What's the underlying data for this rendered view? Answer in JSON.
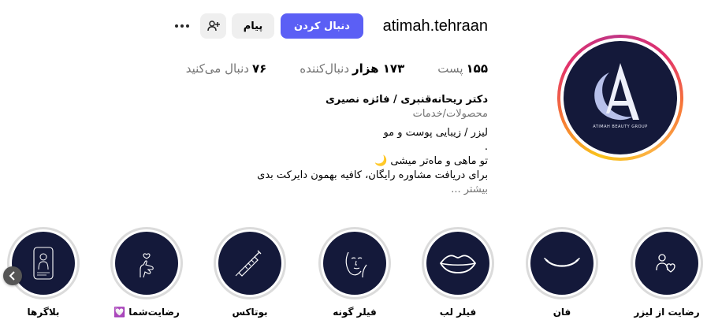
{
  "profile": {
    "username": "atimah.tehraan",
    "avatar_brand": "ATIMAH BEAUTY GROUP"
  },
  "actions": {
    "follow_label": "دنبال کردن",
    "message_label": "پیام",
    "add_user_icon": "person-add-icon",
    "more_icon": "more-horizontal-icon"
  },
  "stats": {
    "posts_count": "۱۵۵",
    "posts_label": "پست",
    "followers_count": "۱۷۳ هزار",
    "followers_label": "دنبال‌کننده",
    "following_count": "۷۶",
    "following_label": "دنبال می‌کنید"
  },
  "bio": {
    "name": "دکتر ریحانه‌قنبری / فائزه نصیری",
    "category": "محصولات/خدمات",
    "lines": [
      "لیزر / زیبایی پوست و مو",
      ".",
      "تو ماهی و ماه‌تر میشی 🌙",
      "برای دریافت مشاوره رایگان، کافیه بهمون دایرکت بدی"
    ],
    "more": "بیشتر ..."
  },
  "highlights": [
    {
      "label": "رضایت از لیزر",
      "icon": "hands-heart-icon"
    },
    {
      "label": "فان",
      "icon": "smile-icon"
    },
    {
      "label": "فیلر لب",
      "icon": "lips-icon"
    },
    {
      "label": "فیلر گونه",
      "icon": "face-icon"
    },
    {
      "label": "بوتاکس",
      "icon": "syringe-icon"
    },
    {
      "label": "رضایت‌شما 💟",
      "icon": "finger-heart-icon"
    },
    {
      "label": "بلاگرها",
      "icon": "blogger-icon"
    }
  ],
  "colors": {
    "follow_button": "#5b5ff5",
    "highlight_bg": "#14193a",
    "secondary_text": "#737373"
  }
}
